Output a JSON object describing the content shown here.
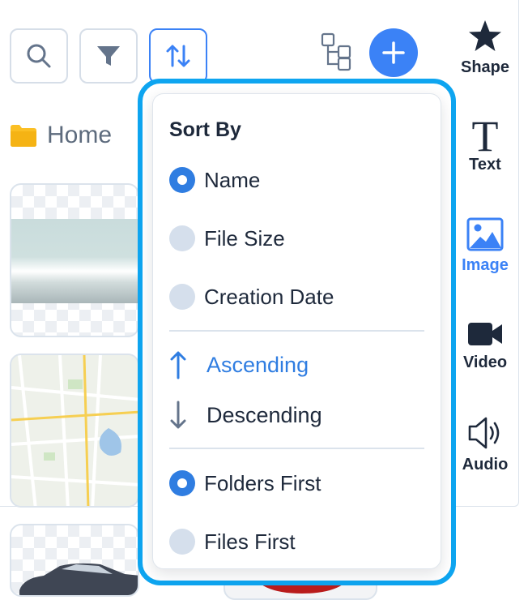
{
  "toolbar": {
    "search_icon": "search-icon",
    "filter_icon": "filter-icon",
    "sort_icon": "sort-arrows-icon",
    "tree_icon": "hierarchy-icon",
    "add_icon": "plus-icon"
  },
  "breadcrumb": {
    "label": "Home",
    "icon": "folder-icon"
  },
  "sidebar": {
    "items": [
      {
        "label": "Shape",
        "icon": "star-icon",
        "active": false
      },
      {
        "label": "Text",
        "icon": "text-T-icon",
        "active": false
      },
      {
        "label": "Image",
        "icon": "image-icon",
        "active": true
      },
      {
        "label": "Video",
        "icon": "video-camera-icon",
        "active": false
      },
      {
        "label": "Audio",
        "icon": "speaker-icon",
        "active": false
      }
    ]
  },
  "sort_menu": {
    "title": "Sort By",
    "sort_options": [
      {
        "label": "Name",
        "checked": true
      },
      {
        "label": "File Size",
        "checked": false
      },
      {
        "label": "Creation Date",
        "checked": false
      }
    ],
    "directions": [
      {
        "label": "Ascending",
        "icon": "arrow-up-icon",
        "active": true
      },
      {
        "label": "Descending",
        "icon": "arrow-down-icon",
        "active": false
      }
    ],
    "grouping_options": [
      {
        "label": "Folders First",
        "checked": true
      },
      {
        "label": "Files First",
        "checked": false
      }
    ]
  },
  "colors": {
    "accent": "#3b82f6",
    "highlight_border": "#0ea5f0",
    "radio_unchecked": "#d5dfec",
    "text": "#1e293b"
  }
}
